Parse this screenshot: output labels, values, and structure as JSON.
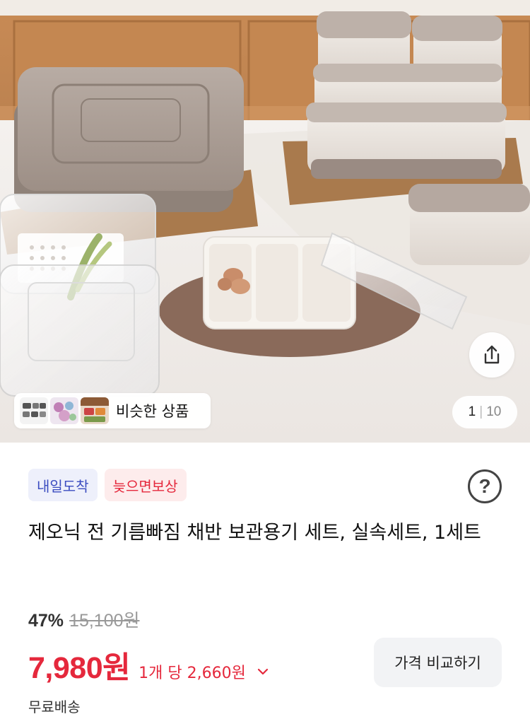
{
  "hero": {
    "image": "food storage containers product photo",
    "share_icon": "share-icon",
    "similar_label": "비슷한 상품",
    "counter_current": "1",
    "counter_sep": "|",
    "counter_total": "10"
  },
  "badges": {
    "delivery": "내일도착",
    "late_comp": "늦으면보상"
  },
  "help_icon": "question-icon",
  "help_symbol": "?",
  "product": {
    "title": "제오닉 전 기름빠짐 채반 보관용기 세트, 실속세트, 1세트",
    "discount_pct": "47%",
    "original_price": "15,100원",
    "price": "7,980원",
    "unit_price": "1개 당 2,660원",
    "compare_label": "가격 비교하기",
    "shipping": "무료배송"
  },
  "colors": {
    "accent_red": "#e5283c",
    "accent_blue": "#3b4cc0"
  }
}
